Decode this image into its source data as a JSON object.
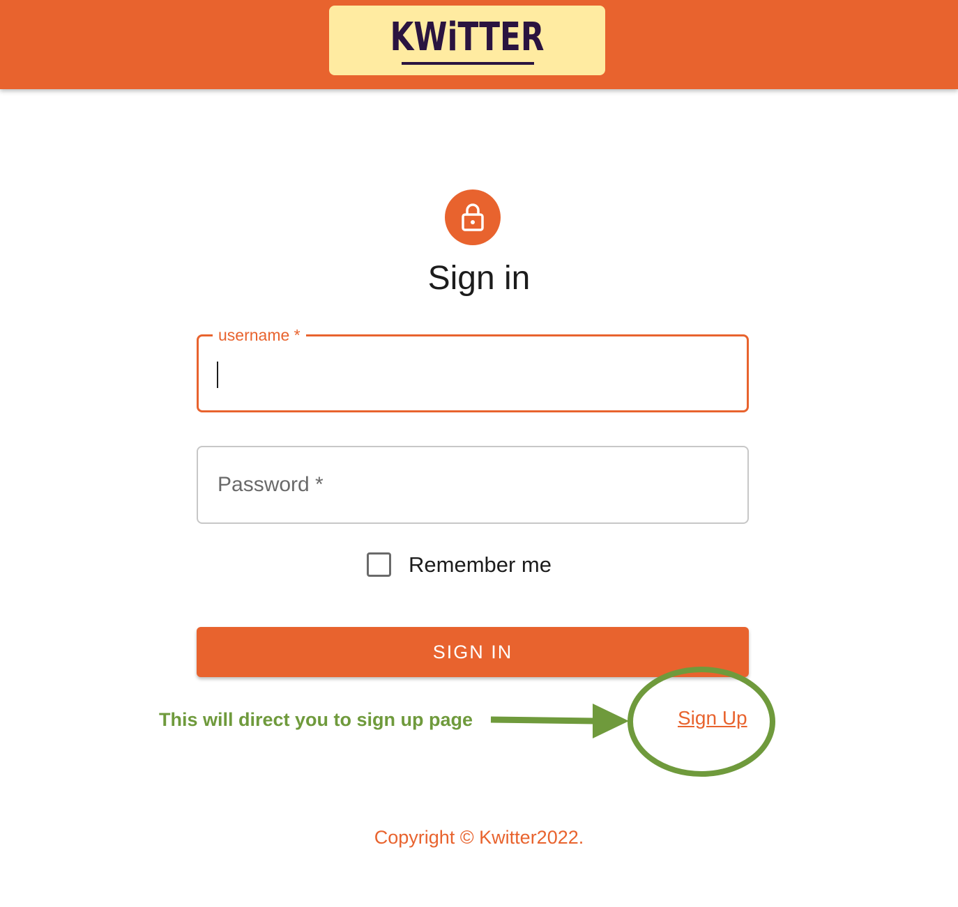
{
  "header": {
    "logo_text": "KWiTTER"
  },
  "page": {
    "title": "Sign in"
  },
  "form": {
    "username_label": "username *",
    "username_value": "",
    "password_placeholder": "Password *",
    "remember_label": "Remember me",
    "remember_checked": false,
    "submit_label": "SIGN IN",
    "signup_link": "Sign Up"
  },
  "annotation": {
    "text": "This will direct you to sign up page"
  },
  "footer": {
    "copyright": "Copyright © Kwitter2022."
  },
  "colors": {
    "brand": "#e8632e",
    "logo_bg": "#ffeba1",
    "logo_text": "#2a1440",
    "annotation": "#6f9a3c"
  },
  "icons": {
    "avatar": "lock-icon"
  }
}
